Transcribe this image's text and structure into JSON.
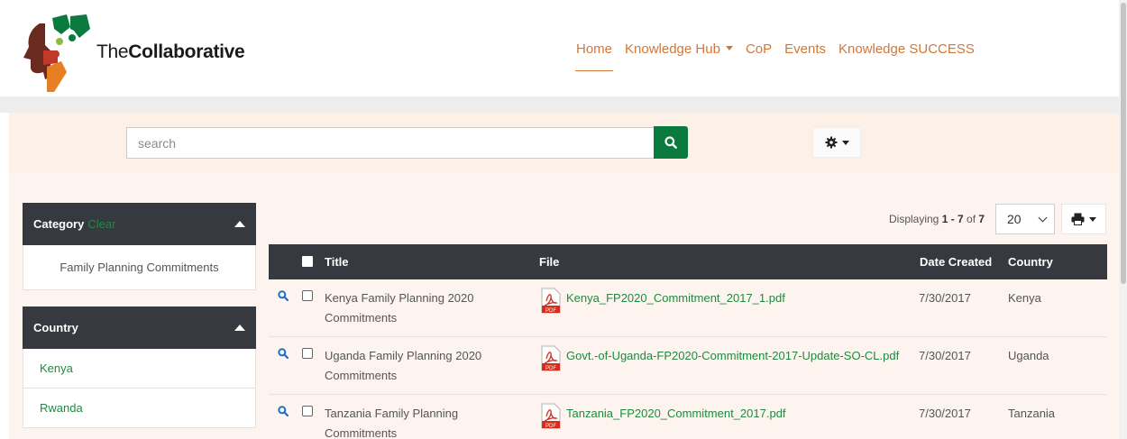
{
  "brand": {
    "prefix": "The",
    "name": "Collaborative"
  },
  "nav": {
    "items": [
      {
        "label": "Home",
        "active": true
      },
      {
        "label": "Knowledge Hub",
        "dropdown": true
      },
      {
        "label": "CoP"
      },
      {
        "label": "Events"
      },
      {
        "label": "Knowledge SUCCESS"
      }
    ]
  },
  "search": {
    "placeholder": "search",
    "value": ""
  },
  "sidebar": {
    "category": {
      "title": "Category",
      "clear_label": "Clear",
      "items": [
        "Family Planning Commitments"
      ]
    },
    "country": {
      "title": "Country",
      "items": [
        "Kenya",
        "Rwanda"
      ]
    }
  },
  "results": {
    "displaying_prefix": "Displaying ",
    "range": "1 - 7",
    "of_label": " of ",
    "total": "7",
    "per_page": "20",
    "columns": {
      "title": "Title",
      "file": "File",
      "date": "Date Created",
      "country": "Country"
    },
    "rows": [
      {
        "title": "Kenya Family Planning 2020 Commitments",
        "file": "Kenya_FP2020_Commitment_2017_1.pdf",
        "date": "7/30/2017",
        "country": "Kenya"
      },
      {
        "title": "Uganda Family Planning 2020 Commitments",
        "file": "Govt.-of-Uganda-FP2020-Commitment-2017-Update-SO-CL.pdf",
        "date": "7/30/2017",
        "country": "Uganda"
      },
      {
        "title": "Tanzania Family Planning Commitments",
        "file": "Tanzania_FP2020_Commitment_2017.pdf",
        "date": "7/30/2017",
        "country": "Tanzania"
      }
    ]
  },
  "colors": {
    "accent_orange": "#d2773a",
    "brand_green": "#0b7a3e",
    "link_green": "#1f8a3f",
    "dark_header": "#363a40",
    "page_tint": "#fdf4ef"
  },
  "icons": {
    "search_button": "search-icon",
    "settings": "gear-icon",
    "print": "print-icon",
    "row_view": "magnifier-icon",
    "file_type": "pdf-icon"
  }
}
